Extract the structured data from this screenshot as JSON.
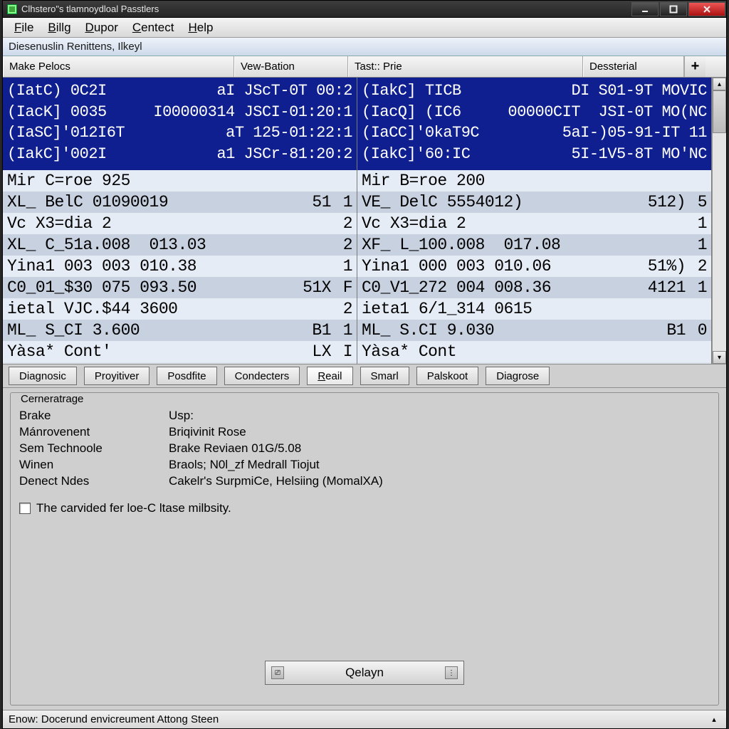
{
  "window": {
    "title": "Clhstero\"s tlamnoydloal Passtlers"
  },
  "menu": {
    "items": [
      "File",
      "Billg",
      "Dupor",
      "Centect",
      "Help"
    ]
  },
  "subbar": {
    "text": "Diesenuslin Renittens, Ilkeyl"
  },
  "headers": {
    "left1": "Make Pelocs",
    "left2": "Vew-Bation",
    "right1": "Tast:: Prie",
    "right2": "Dessterial",
    "plus": "+"
  },
  "left_blue": [
    {
      "c1": "(IatC) 0C2I",
      "c2": "",
      "c3": "aI JScT-0T 00:2"
    },
    {
      "c1": "(IacK] 0035",
      "c2": "I00000314",
      "c3": "JSCI-01:20:1"
    },
    {
      "c1": "(IaSC]'012I6T",
      "c2": "",
      "c3": "aT 125-01:22:1"
    },
    {
      "c1": "(IakC]'002I",
      "c2": "",
      "c3": "a1 JSCr-81:20:2"
    }
  ],
  "right_blue": [
    {
      "c1": "(IakC] TICB",
      "c2": "",
      "c3": "DI S01-9T MOVIC"
    },
    {
      "c1": "(IacQ] (IC6",
      "c2": "00000CIT",
      "c3": "JSI-0T MO(NC"
    },
    {
      "c1": "(IaCC]'0kaT9C",
      "c2": "",
      "c3": "5aI-)05-91-IT 11"
    },
    {
      "c1": "(IakC]'60:IC",
      "c2": "",
      "c3": "5I-1V5-8T MO'NC"
    }
  ],
  "left_rows": [
    {
      "t": "Mir C=roe 925",
      "c2": "",
      "c3": ""
    },
    {
      "t": "XL_ BelC 01090019",
      "c2": "51",
      "c3": "1"
    },
    {
      "t": "Vc X3=dia 2",
      "c2": "",
      "c3": "2"
    },
    {
      "t": "XL_ C_51a.008  013.03",
      "c2": "",
      "c3": "2"
    },
    {
      "t": "Yina1 003 003 010.38",
      "c2": "",
      "c3": "1"
    },
    {
      "t": "C0_01_$30 075 093.50",
      "c2": "51X",
      "c3": "F"
    },
    {
      "t": "ietal VJC.$44 3600",
      "c2": "",
      "c3": "2"
    },
    {
      "t": "ML_ S_CI 3.600",
      "c2": "B1",
      "c3": "1"
    },
    {
      "t": "Yàsa* Cont'",
      "c2": "LX",
      "c3": "I"
    }
  ],
  "right_rows": [
    {
      "t": "Mir B=roe 200",
      "c2": "",
      "c3": ""
    },
    {
      "t": "VE_ DelC 5554012)",
      "c2": "512)",
      "c3": "5"
    },
    {
      "t": "Vc X3=dia 2",
      "c2": "",
      "c3": "1"
    },
    {
      "t": "XF_ L_100.008  017.08",
      "c2": "",
      "c3": "1"
    },
    {
      "t": "Yina1 000 003 010.06",
      "c2": "51%)",
      "c3": "2"
    },
    {
      "t": "C0_V1_272 004 008.36",
      "c2": "4121",
      "c3": "1"
    },
    {
      "t": "ieta1 6/1_314 0615",
      "c2": "",
      "c3": ""
    },
    {
      "t": "ML_ S.CI 9.030",
      "c2": "B1",
      "c3": "0"
    },
    {
      "t": "Yàsa* Cont",
      "c2": "",
      "c3": ""
    }
  ],
  "tabs": [
    "Diagnosic",
    "Proyitiver",
    "Posdfite",
    "Condecters",
    "Reail",
    "Smarl",
    "Palskoot",
    "Diagrose"
  ],
  "group": {
    "label": "Cerneratrage",
    "pairs": [
      {
        "k": "Brake",
        "v": "Usp:"
      },
      {
        "k": "Mánrovenent",
        "v": "Briqivinit Rose"
      },
      {
        "k": "Sem Technoole",
        "v": "Brake Reviaen 01G/5.08"
      },
      {
        "k": "Winen",
        "v": "Braols; N0l_zf Medrall Tiojut"
      },
      {
        "k": "Denect Ndes",
        "v": "Cakelr's SurpmiCe, Helsiing (MomalXA)"
      }
    ],
    "checkbox_label": "The carvided fer loe-C ltase milbsity.",
    "button": "Qelayn"
  },
  "status": {
    "text": "Enow: Docerund envicreument Attong Steen"
  }
}
